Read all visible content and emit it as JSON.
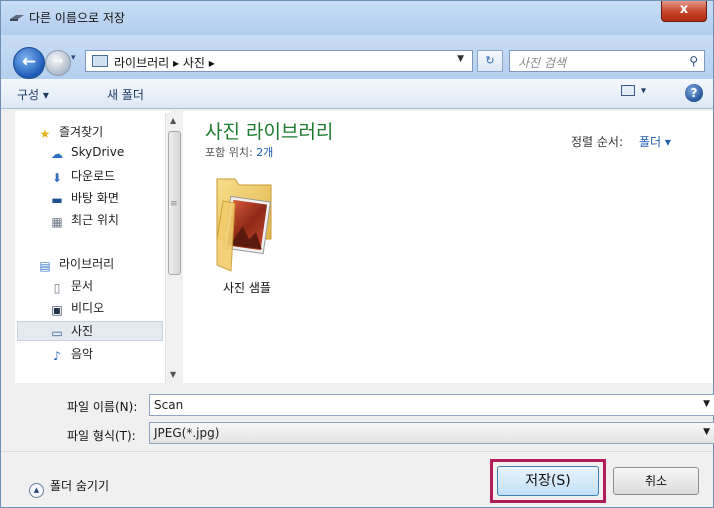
{
  "window": {
    "title": "다른 이름으로 저장",
    "close_label": "x"
  },
  "navigation": {
    "breadcrumb": "라이브러리 ▸ 사진 ▸",
    "search_placeholder": "사진 검색"
  },
  "toolbar": {
    "organize_label": "구성 ▾",
    "new_folder_label": "새 폴더",
    "view_dropdown": "▾",
    "help_label": "?"
  },
  "sidebar": {
    "favorites_label": "즐겨찾기",
    "favorites": [
      {
        "label": "SkyDrive",
        "icon": "skydrive-icon"
      },
      {
        "label": "다운로드",
        "icon": "download-folder-icon"
      },
      {
        "label": "바탕 화면",
        "icon": "desktop-icon"
      },
      {
        "label": "최근 위치",
        "icon": "recent-places-icon"
      }
    ],
    "libraries_label": "라이브러리",
    "libraries": [
      {
        "label": "문서",
        "icon": "documents-icon"
      },
      {
        "label": "비디오",
        "icon": "videos-icon"
      },
      {
        "label": "사진",
        "icon": "pictures-icon",
        "selected": true
      },
      {
        "label": "음악",
        "icon": "music-icon"
      }
    ]
  },
  "content": {
    "library_title": "사진 라이브러리",
    "includes_label": "포함 위치:",
    "includes_count": "2개",
    "sort_label": "정렬 순서:",
    "sort_value": "폴더 ▾",
    "items": [
      {
        "label": "사진 샘플",
        "icon": "folder-icon"
      }
    ]
  },
  "form": {
    "file_name_label": "파일 이름(N):",
    "file_name_value": "Scan",
    "file_type_label": "파일 형식(T):",
    "file_type_value": "JPEG(*.jpg)"
  },
  "footer": {
    "hide_folders_label": "폴더 숨기기",
    "save_label": "저장(S)",
    "cancel_label": "취소"
  },
  "colors": {
    "library_title": "#1e7c2f",
    "link": "#1e5fb4",
    "highlight_border": "#b01c5a"
  }
}
